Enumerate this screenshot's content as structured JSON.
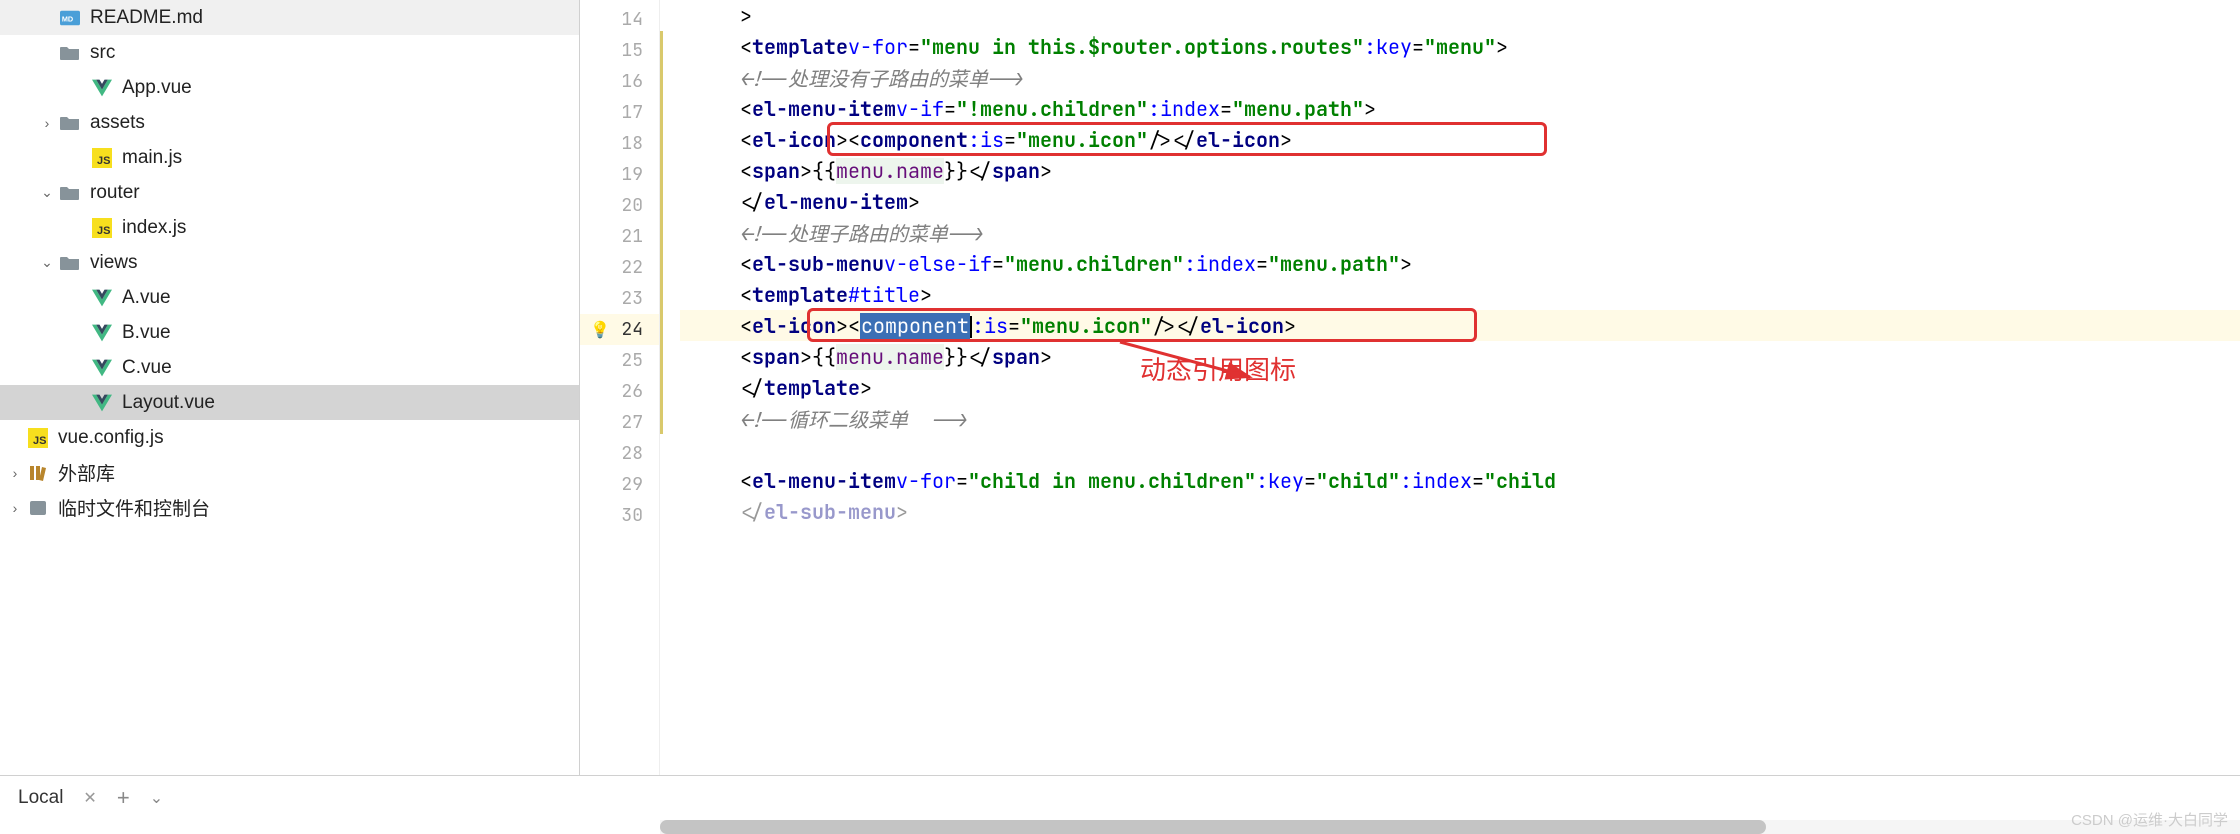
{
  "sidebar": {
    "items": [
      {
        "label": "README.md",
        "icon": "md",
        "indent": 1,
        "chev": ""
      },
      {
        "label": "src",
        "icon": "folder",
        "indent": 1,
        "chev": ""
      },
      {
        "label": "App.vue",
        "icon": "vue",
        "indent": 2,
        "chev": ""
      },
      {
        "label": "assets",
        "icon": "folder",
        "indent": 1,
        "chev": "›"
      },
      {
        "label": "main.js",
        "icon": "js",
        "indent": 2,
        "chev": ""
      },
      {
        "label": "router",
        "icon": "folder",
        "indent": 1,
        "chev": "⌄"
      },
      {
        "label": "index.js",
        "icon": "js",
        "indent": 2,
        "chev": ""
      },
      {
        "label": "views",
        "icon": "folder",
        "indent": 1,
        "chev": "⌄"
      },
      {
        "label": "A.vue",
        "icon": "vue",
        "indent": 2,
        "chev": ""
      },
      {
        "label": "B.vue",
        "icon": "vue",
        "indent": 2,
        "chev": ""
      },
      {
        "label": "C.vue",
        "icon": "vue",
        "indent": 2,
        "chev": ""
      },
      {
        "label": "Layout.vue",
        "icon": "vue",
        "indent": 2,
        "chev": "",
        "selected": true
      },
      {
        "label": "vue.config.js",
        "icon": "js",
        "indent": 0,
        "chev": ""
      },
      {
        "label": "外部库",
        "icon": "lib",
        "indent": 0,
        "chev": "›"
      },
      {
        "label": "临时文件和控制台",
        "icon": "scratch",
        "indent": 0,
        "chev": "›"
      }
    ]
  },
  "lines": {
    "start": 14,
    "end": 30,
    "highlighted": 24,
    "changed": [
      15,
      16,
      17,
      18,
      19,
      20,
      21,
      22,
      23,
      24,
      25,
      26,
      27
    ]
  },
  "code": {
    "l14": {
      "indent": 8,
      "text": ">"
    },
    "l15_tag": "template",
    "l15_attr": "v-for",
    "l15_val": "menu in this.$router.options.routes",
    "l15_key": ":key",
    "l15_keyval": "menu",
    "l16_cmt": "<!--处理没有子路由的菜单-->",
    "l17_tag": "el-menu-item",
    "l17_a1": "v-if",
    "l17_v1": "!menu.children",
    "l17_a2": ":index",
    "l17_v2": "menu.path",
    "l18_t1": "el-icon",
    "l18_t2": "component",
    "l18_a": ":is",
    "l18_v": "menu.icon",
    "l19_tag": "span",
    "l19_open": "{{",
    "l19_expr": "menu.name",
    "l19_close": "}}",
    "l20_tag": "el-menu-item",
    "l21_cmt": "<!--处理子路由的菜单-->",
    "l22_tag": "el-sub-menu",
    "l22_a1": "v-else-if",
    "l22_v1": "menu.children",
    "l22_a2": ":index",
    "l22_v2": "menu.path",
    "l23_tag": "template",
    "l23_attr": "#title",
    "l24_t1": "el-icon",
    "l24_t2": "component",
    "l24_a": ":is",
    "l24_v": "menu.icon",
    "l25_tag": "span",
    "l25_open": "{{",
    "l25_expr": "menu.name",
    "l25_close": "}}",
    "l26_tag": "template",
    "l27_cmt": "<!--循环二级菜单  -->",
    "l29_tag": "el-menu-item",
    "l29_a1": "v-for",
    "l29_v1": "child in menu.children",
    "l29_a2": ":key",
    "l29_v2": "child",
    "l29_a3": ":index",
    "l29_v3": "child",
    "l30_tag": "el-sub-menu"
  },
  "annotation": "动态引用图标",
  "bottom": {
    "tab": "Local"
  },
  "watermark": "CSDN @运维·大白同学"
}
